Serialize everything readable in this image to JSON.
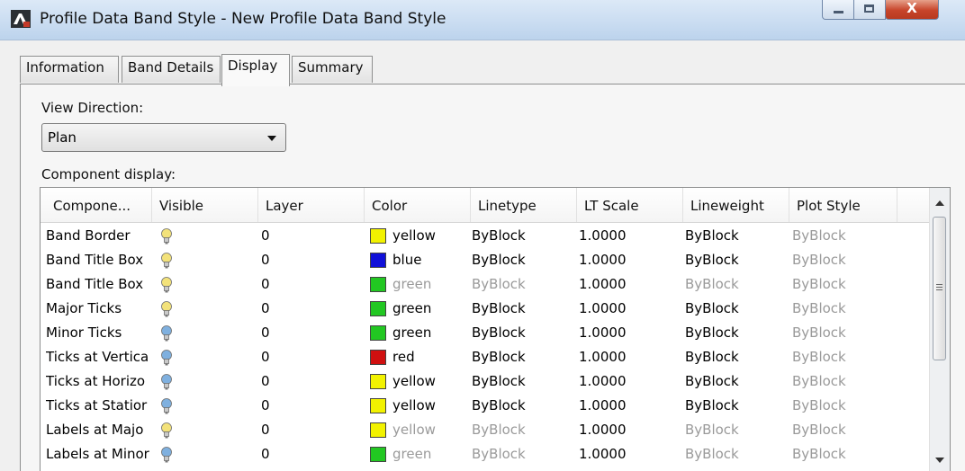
{
  "window": {
    "title": "Profile Data Band Style - New Profile Data Band Style",
    "close_label": "X"
  },
  "tabs": [
    {
      "label": "Information"
    },
    {
      "label": "Band Details"
    },
    {
      "label": "Display"
    },
    {
      "label": "Summary"
    }
  ],
  "active_tab": "Display",
  "view_direction": {
    "label": "View Direction:",
    "value": "Plan"
  },
  "component_display": {
    "label": "Component display:"
  },
  "columns": [
    "Compone...",
    "Visible",
    "Layer",
    "Color",
    "Linetype",
    "LT Scale",
    "Lineweight",
    "Plot Style"
  ],
  "rows": [
    {
      "component": "Band Border",
      "visible": "on",
      "layer": "0",
      "color": "yellow",
      "color_hex": "#f2f200",
      "linetype": "ByBlock",
      "lt_scale": "1.0000",
      "lineweight": "ByBlock",
      "plot_style": "ByBlock",
      "dim": false
    },
    {
      "component": "Band Title Box",
      "visible": "on",
      "layer": "0",
      "color": "blue",
      "color_hex": "#1010d8",
      "linetype": "ByBlock",
      "lt_scale": "1.0000",
      "lineweight": "ByBlock",
      "plot_style": "ByBlock",
      "dim": false
    },
    {
      "component": "Band Title Box",
      "visible": "on",
      "layer": "0",
      "color": "green",
      "color_hex": "#22c722",
      "linetype": "ByBlock",
      "lt_scale": "1.0000",
      "lineweight": "ByBlock",
      "plot_style": "ByBlock",
      "dim": true
    },
    {
      "component": "Major Ticks",
      "visible": "on",
      "layer": "0",
      "color": "green",
      "color_hex": "#22c722",
      "linetype": "ByBlock",
      "lt_scale": "1.0000",
      "lineweight": "ByBlock",
      "plot_style": "ByBlock",
      "dim": false
    },
    {
      "component": "Minor Ticks",
      "visible": "off",
      "layer": "0",
      "color": "green",
      "color_hex": "#22c722",
      "linetype": "ByBlock",
      "lt_scale": "1.0000",
      "lineweight": "ByBlock",
      "plot_style": "ByBlock",
      "dim": false
    },
    {
      "component": "Ticks at Vertica",
      "visible": "off",
      "layer": "0",
      "color": "red",
      "color_hex": "#d01010",
      "linetype": "ByBlock",
      "lt_scale": "1.0000",
      "lineweight": "ByBlock",
      "plot_style": "ByBlock",
      "dim": false
    },
    {
      "component": "Ticks at Horizo",
      "visible": "off",
      "layer": "0",
      "color": "yellow",
      "color_hex": "#f2f200",
      "linetype": "ByBlock",
      "lt_scale": "1.0000",
      "lineweight": "ByBlock",
      "plot_style": "ByBlock",
      "dim": false
    },
    {
      "component": "Ticks at Statior",
      "visible": "off",
      "layer": "0",
      "color": "yellow",
      "color_hex": "#f2f200",
      "linetype": "ByBlock",
      "lt_scale": "1.0000",
      "lineweight": "ByBlock",
      "plot_style": "ByBlock",
      "dim": false
    },
    {
      "component": "Labels at Majo",
      "visible": "on",
      "layer": "0",
      "color": "yellow",
      "color_hex": "#f2f200",
      "linetype": "ByBlock",
      "lt_scale": "1.0000",
      "lineweight": "ByBlock",
      "plot_style": "ByBlock",
      "dim": true
    },
    {
      "component": "Labels at Minor",
      "visible": "off",
      "layer": "0",
      "color": "green",
      "color_hex": "#22c722",
      "linetype": "ByBlock",
      "lt_scale": "1.0000",
      "lineweight": "ByBlock",
      "plot_style": "ByBlock",
      "dim": true
    }
  ],
  "icons": {
    "app": "autocad-app-icon",
    "bulb_on": "lightbulb-on-icon",
    "bulb_off": "lightbulb-off-icon"
  },
  "colors": {
    "bulb_on": "#f3e27a",
    "bulb_off": "#7fb0df",
    "titlebar": "#c9dcf1"
  }
}
